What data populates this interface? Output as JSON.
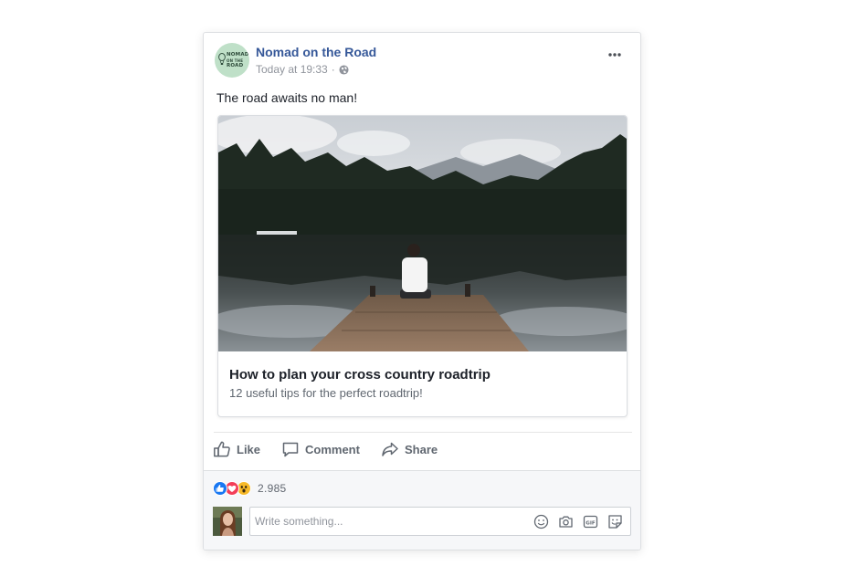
{
  "post": {
    "page_name": "Nomad on the Road",
    "avatar_logo_line1": "NOMAD",
    "avatar_logo_line2": "ON THE",
    "avatar_logo_line3": "ROAD",
    "timestamp": "Today at 19:33",
    "separator": "·",
    "privacy_icon": "globe-icon",
    "text": "The road awaits no man!"
  },
  "link_preview": {
    "title": "How to plan your cross country roadtrip",
    "subtitle": "12 useful tips for the perfect roadtrip!"
  },
  "actions": {
    "like_label": "Like",
    "comment_label": "Comment",
    "share_label": "Share"
  },
  "reactions": {
    "types": [
      "like",
      "love",
      "wow"
    ],
    "count": "2.985"
  },
  "comment": {
    "placeholder": "Write something...",
    "icons": [
      "emoji-icon",
      "camera-icon",
      "gif-icon",
      "sticker-icon"
    ]
  },
  "colors": {
    "brand_blue": "#365899",
    "like_blue": "#1877f2",
    "love_red": "#f33e58",
    "wow_yellow": "#f7b928",
    "muted_text": "#606770"
  }
}
